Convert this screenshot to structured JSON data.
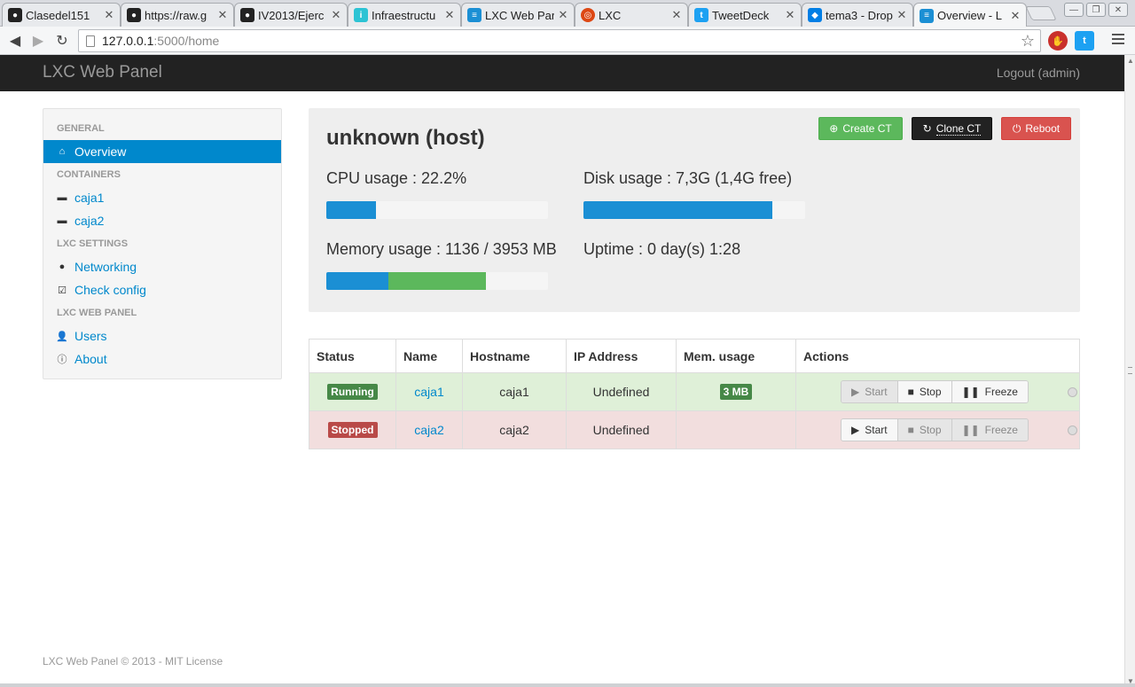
{
  "browser": {
    "tabs": [
      {
        "title": "Clasedel151",
        "icon": "github-icon"
      },
      {
        "title": "https://raw.g",
        "icon": "github-icon"
      },
      {
        "title": "IV2013/Ejerc",
        "icon": "github-icon"
      },
      {
        "title": "Infraestructu",
        "icon": "site-icon"
      },
      {
        "title": "LXC Web Par",
        "icon": "lxc-icon"
      },
      {
        "title": "LXC",
        "icon": "ubuntu-icon"
      },
      {
        "title": "TweetDeck",
        "icon": "twitter-icon"
      },
      {
        "title": "tema3 - Drop",
        "icon": "dropbox-icon"
      },
      {
        "title": "Overview - L",
        "icon": "lxc-icon"
      }
    ],
    "url_host": "127.0.0.1",
    "url_path": ":5000/home"
  },
  "app": {
    "brand": "LXC Web Panel",
    "logout": "Logout (admin)"
  },
  "sidebar": {
    "headers": [
      "GENERAL",
      "CONTAINERS",
      "LXC SETTINGS",
      "LXC WEB PANEL"
    ],
    "items": [
      {
        "label": "Overview",
        "icon": "home-icon"
      },
      {
        "label": "caja1",
        "icon": "drive-icon"
      },
      {
        "label": "caja2",
        "icon": "drive-icon"
      },
      {
        "label": "Networking",
        "icon": "globe-icon"
      },
      {
        "label": "Check config",
        "icon": "check-icon"
      },
      {
        "label": "Users",
        "icon": "user-icon"
      },
      {
        "label": "About",
        "icon": "info-icon"
      }
    ]
  },
  "host": {
    "title": "unknown (host)",
    "cpu_label": "CPU usage : 22.2%",
    "cpu_percent": 22.2,
    "disk_label": "Disk usage : 7,3G (1,4G free)",
    "disk_percent": 85,
    "memory_label": "Memory usage : 1136 / 3953 MB",
    "memory_used_percent": 28,
    "memory_cached_percent": 44,
    "uptime_label": "Uptime : 0 day(s) 1:28",
    "buttons": {
      "create": "Create CT",
      "clone": "Clone CT",
      "reboot": "Reboot"
    }
  },
  "table": {
    "headers": [
      "Status",
      "Name",
      "Hostname",
      "IP Address",
      "Mem. usage",
      "Actions"
    ],
    "rows": [
      {
        "status": "Running",
        "name": "caja1",
        "hostname": "caja1",
        "ip": "Undefined",
        "mem": "3 MB"
      },
      {
        "status": "Stopped",
        "name": "caja2",
        "hostname": "caja2",
        "ip": "Undefined",
        "mem": ""
      }
    ],
    "actions": {
      "start": "Start",
      "stop": "Stop",
      "freeze": "Freeze"
    }
  },
  "footer": "LXC Web Panel © 2013 - MIT License"
}
